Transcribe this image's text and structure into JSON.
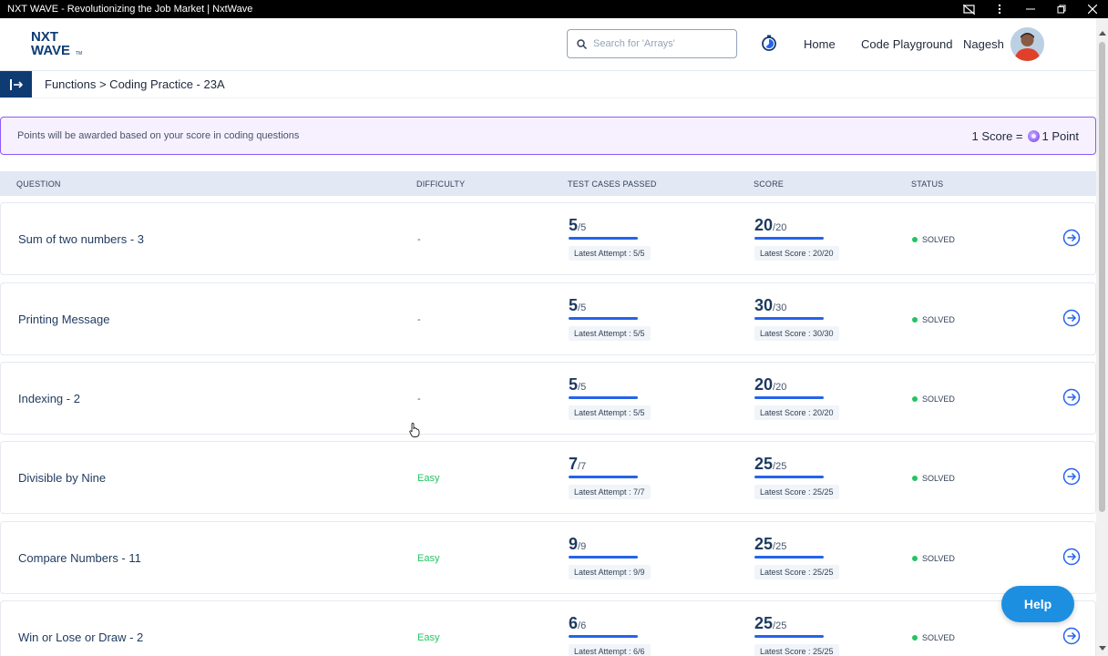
{
  "window": {
    "title": "NXT WAVE - Revolutionizing the Job Market | NxtWave"
  },
  "header": {
    "logo_line1": "NXT",
    "logo_line2": "WAVE",
    "logo_tm": "TM",
    "search_placeholder": "Search for 'Arrays'",
    "nav_home": "Home",
    "nav_code_playground": "Code Playground",
    "username": "Nagesh"
  },
  "breadcrumb": {
    "text": "Functions > Coding Practice - 23A"
  },
  "banner": {
    "info": "Points will be awarded based on your score in coding questions",
    "conv_left": "1 Score =",
    "conv_right": "1 Point"
  },
  "table": {
    "headers": {
      "question": "QUESTION",
      "difficulty": "DIFFICULTY",
      "test_cases": "TEST CASES PASSED",
      "score": "SCORE",
      "status": "STATUS"
    },
    "rows": [
      {
        "name": "Sum of two numbers - 3",
        "difficulty": "-",
        "tc_passed": "5",
        "tc_total": "/5",
        "tc_latest": "Latest Attempt : 5/5",
        "score": "20",
        "score_total": "/20",
        "score_latest": "Latest Score : 20/20",
        "status": "SOLVED"
      },
      {
        "name": "Printing Message",
        "difficulty": "-",
        "tc_passed": "5",
        "tc_total": "/5",
        "tc_latest": "Latest Attempt : 5/5",
        "score": "30",
        "score_total": "/30",
        "score_latest": "Latest Score : 30/30",
        "status": "SOLVED"
      },
      {
        "name": "Indexing - 2",
        "difficulty": "-",
        "tc_passed": "5",
        "tc_total": "/5",
        "tc_latest": "Latest Attempt : 5/5",
        "score": "20",
        "score_total": "/20",
        "score_latest": "Latest Score : 20/20",
        "status": "SOLVED"
      },
      {
        "name": "Divisible by Nine",
        "difficulty": "Easy",
        "tc_passed": "7",
        "tc_total": "/7",
        "tc_latest": "Latest Attempt : 7/7",
        "score": "25",
        "score_total": "/25",
        "score_latest": "Latest Score : 25/25",
        "status": "SOLVED"
      },
      {
        "name": "Compare Numbers - 11",
        "difficulty": "Easy",
        "tc_passed": "9",
        "tc_total": "/9",
        "tc_latest": "Latest Attempt : 9/9",
        "score": "25",
        "score_total": "/25",
        "score_latest": "Latest Score : 25/25",
        "status": "SOLVED"
      },
      {
        "name": "Win or Lose or Draw - 2",
        "difficulty": "Easy",
        "tc_passed": "6",
        "tc_total": "/6",
        "tc_latest": "Latest Attempt : 6/6",
        "score": "25",
        "score_total": "/25",
        "score_latest": "Latest Score : 25/25",
        "status": "SOLVED"
      }
    ]
  },
  "help_button": "Help",
  "colors": {
    "brand_blue": "#0f3b73",
    "accent_blue": "#2563eb",
    "easy_green": "#22c55e",
    "banner_purple": "#8b5cf6",
    "help_blue": "#1d8fe0"
  }
}
